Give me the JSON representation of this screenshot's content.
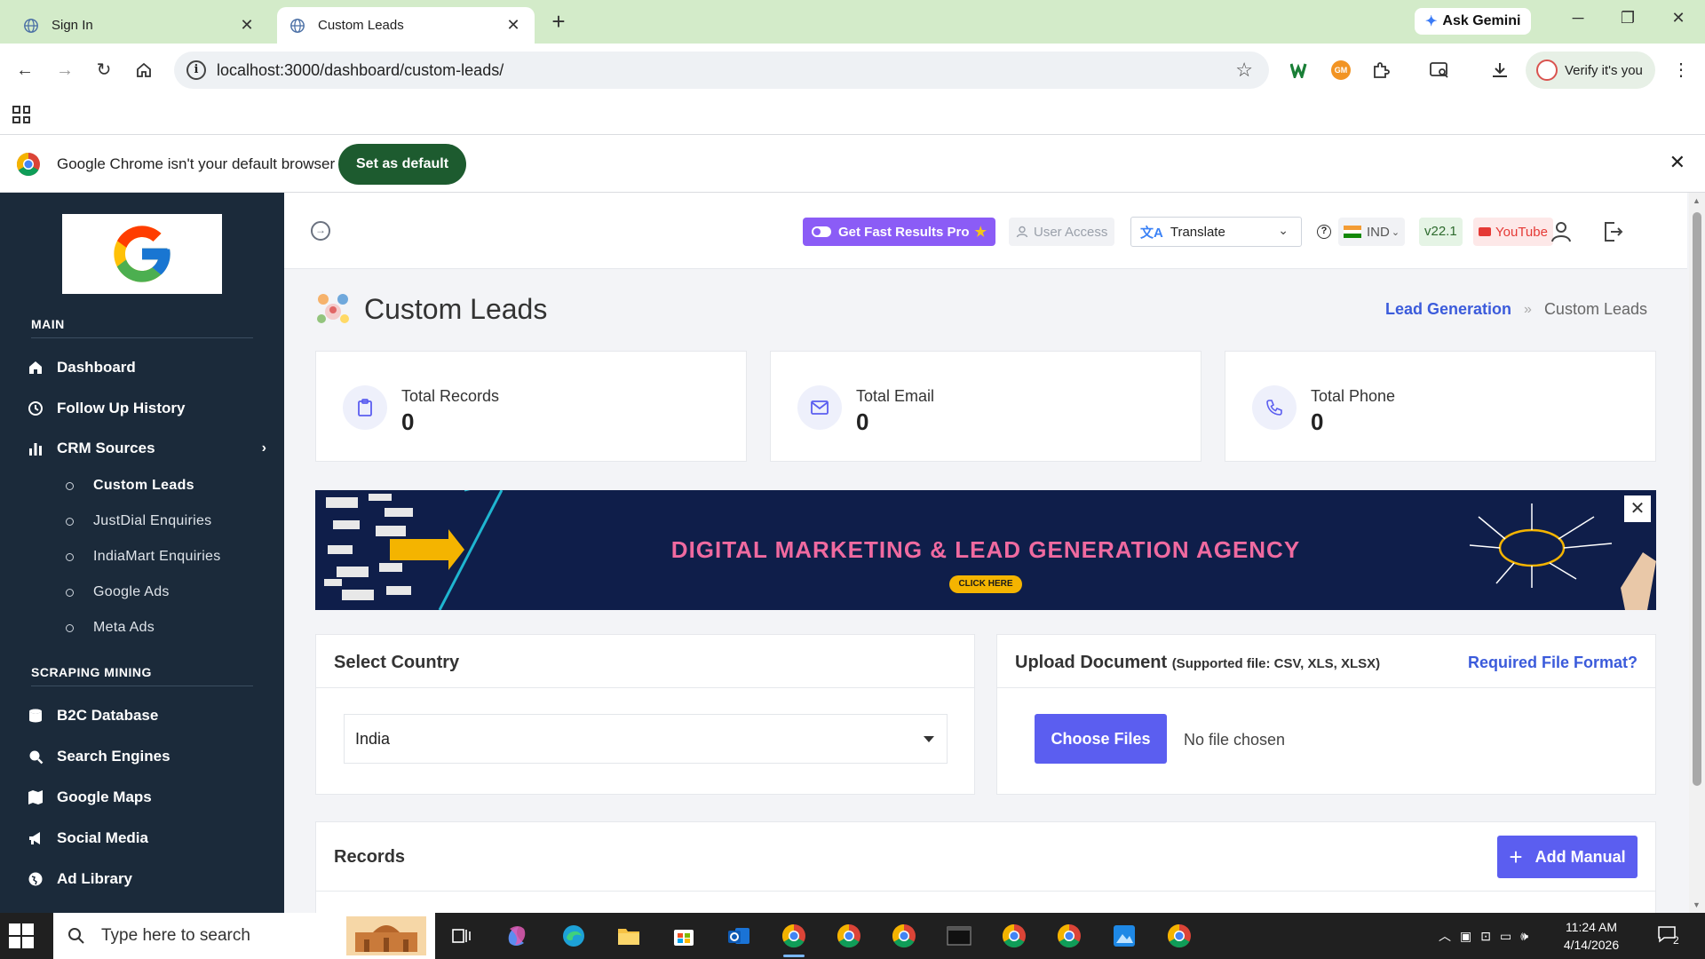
{
  "browser": {
    "tabs": [
      {
        "title": "Sign In"
      },
      {
        "title": "Custom Leads"
      }
    ],
    "url": "localhost:3000/dashboard/custom-leads/",
    "ask_gemini": "Ask Gemini",
    "verify_label": "Verify it's you",
    "infobar_message": "Google Chrome isn't your default browser",
    "set_default_label": "Set as default",
    "extension_badge": "GM"
  },
  "sidebar": {
    "sections": [
      {
        "title": "MAIN"
      },
      {
        "title": "SCRAPING MINING"
      }
    ],
    "main_items": [
      {
        "label": "Dashboard",
        "icon": "home-icon"
      },
      {
        "label": "Follow Up History",
        "icon": "history-icon"
      },
      {
        "label": "CRM Sources",
        "icon": "bar-chart-icon"
      }
    ],
    "crm_sub_items": [
      {
        "label": "Custom Leads",
        "active": true
      },
      {
        "label": "JustDial Enquiries"
      },
      {
        "label": "IndiaMart Enquiries"
      },
      {
        "label": "Google Ads"
      },
      {
        "label": "Meta Ads"
      }
    ],
    "scraping_items": [
      {
        "label": "B2C Database",
        "icon": "database-icon"
      },
      {
        "label": "Search Engines",
        "icon": "search-icon"
      },
      {
        "label": "Google Maps",
        "icon": "map-icon"
      },
      {
        "label": "Social Media",
        "icon": "megaphone-icon"
      },
      {
        "label": "Ad Library",
        "icon": "globe-icon"
      }
    ]
  },
  "header": {
    "get_pro": "Get Fast Results Pro",
    "user_access": "User Access",
    "translate": "Translate",
    "country": "IND",
    "version": "v22.1",
    "youtube": "YouTube"
  },
  "page": {
    "title": "Custom Leads",
    "breadcrumb": {
      "parent": "Lead Generation",
      "separator": "»",
      "current": "Custom Leads"
    },
    "stats": [
      {
        "label": "Total Records",
        "value": "0",
        "icon": "clipboard-icon"
      },
      {
        "label": "Total Email",
        "value": "0",
        "icon": "mail-icon"
      },
      {
        "label": "Total Phone",
        "value": "0",
        "icon": "phone-icon"
      }
    ],
    "banner": {
      "headline": "DIGITAL MARKETING & LEAD GENERATION AGENCY",
      "cta": "CLICK HERE"
    },
    "select_country": {
      "title": "Select Country",
      "selected": "India"
    },
    "upload": {
      "title": "Upload Document",
      "supported": "(Supported file: CSV, XLS, XLSX)",
      "required_format": "Required File Format?",
      "choose_label": "Choose Files",
      "no_file": "No file chosen"
    },
    "records": {
      "title": "Records",
      "add_manual": "Add Manual"
    }
  },
  "taskbar": {
    "search_placeholder": "Type here to search",
    "time": "11:24 AM",
    "date": "4/14/2026",
    "notifications": "2"
  }
}
